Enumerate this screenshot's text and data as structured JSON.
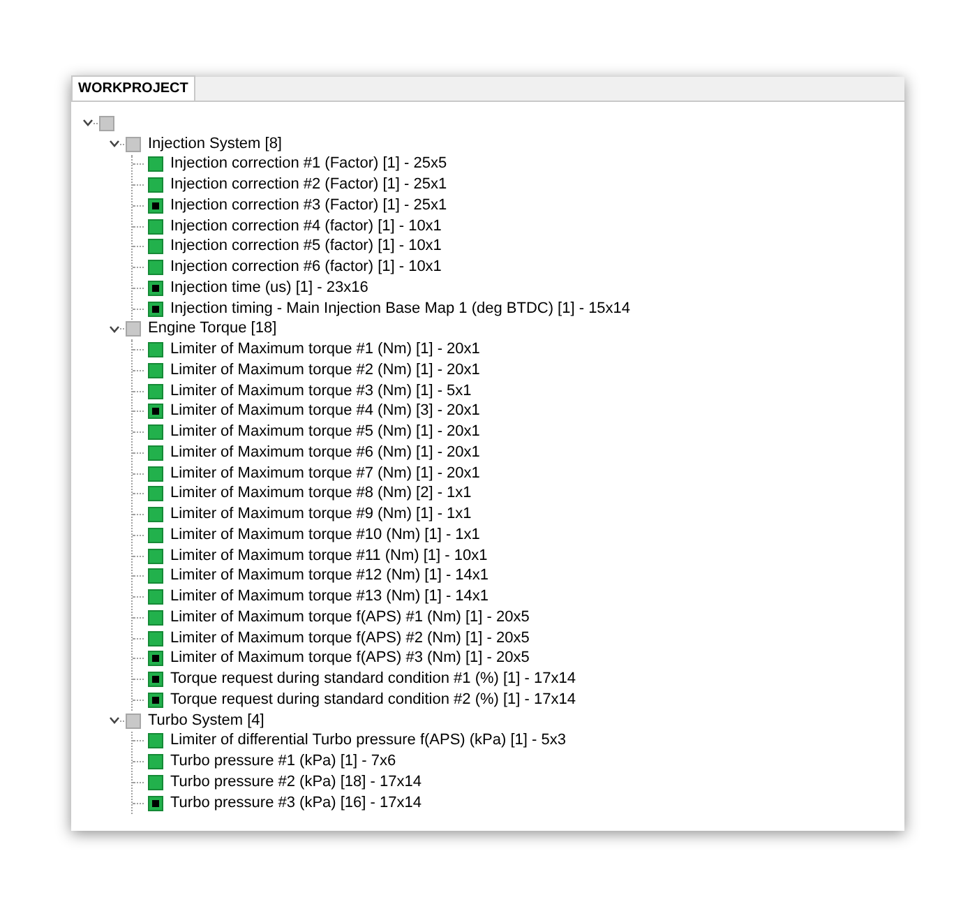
{
  "tab": {
    "label": "WORKPROJECT",
    "selected": true
  },
  "tree": {
    "expanded": true,
    "children": [
      {
        "label": "Injection System [8]",
        "expanded": true,
        "children": [
          {
            "label": "Injection correction #1 (Factor) [1] - 25x5",
            "marked": false
          },
          {
            "label": "Injection correction #2 (Factor) [1] - 25x1",
            "marked": false
          },
          {
            "label": "Injection correction #3 (Factor) [1] - 25x1",
            "marked": true
          },
          {
            "label": "Injection correction #4 (factor) [1] - 10x1",
            "marked": false
          },
          {
            "label": "Injection correction #5 (factor) [1] - 10x1",
            "marked": false
          },
          {
            "label": "Injection correction #6 (factor) [1] - 10x1",
            "marked": false
          },
          {
            "label": "Injection time (us) [1] - 23x16",
            "marked": true
          },
          {
            "label": "Injection timing - Main Injection Base Map 1 (deg BTDC) [1] - 15x14",
            "marked": true
          }
        ]
      },
      {
        "label": "Engine Torque [18]",
        "expanded": true,
        "children": [
          {
            "label": "Limiter of Maximum torque #1 (Nm) [1] - 20x1",
            "marked": false
          },
          {
            "label": "Limiter of Maximum torque #2 (Nm) [1] - 20x1",
            "marked": false
          },
          {
            "label": "Limiter of Maximum torque #3 (Nm) [1] - 5x1",
            "marked": false
          },
          {
            "label": "Limiter of Maximum torque #4 (Nm) [3] - 20x1",
            "marked": true
          },
          {
            "label": "Limiter of Maximum torque #5 (Nm) [1] - 20x1",
            "marked": false
          },
          {
            "label": "Limiter of Maximum torque #6 (Nm) [1] - 20x1",
            "marked": false
          },
          {
            "label": "Limiter of Maximum torque #7 (Nm) [1] - 20x1",
            "marked": false
          },
          {
            "label": "Limiter of Maximum torque #8 (Nm) [2] - 1x1",
            "marked": false
          },
          {
            "label": "Limiter of Maximum torque #9 (Nm) [1] - 1x1",
            "marked": false
          },
          {
            "label": "Limiter of Maximum torque #10 (Nm) [1] - 1x1",
            "marked": false
          },
          {
            "label": "Limiter of Maximum torque #11 (Nm) [1] - 10x1",
            "marked": false
          },
          {
            "label": "Limiter of Maximum torque #12 (Nm) [1] - 14x1",
            "marked": false
          },
          {
            "label": "Limiter of Maximum torque #13 (Nm) [1] - 14x1",
            "marked": false
          },
          {
            "label": "Limiter of Maximum torque f(APS) #1 (Nm) [1] - 20x5",
            "marked": false
          },
          {
            "label": "Limiter of Maximum torque f(APS) #2 (Nm) [1] - 20x5",
            "marked": false
          },
          {
            "label": "Limiter of Maximum torque f(APS) #3 (Nm) [1] - 20x5",
            "marked": true
          },
          {
            "label": "Torque request during standard condition #1 (%) [1] - 17x14",
            "marked": true
          },
          {
            "label": "Torque request during standard condition #2 (%) [1] - 17x14",
            "marked": true
          }
        ]
      },
      {
        "label": "Turbo System [4]",
        "expanded": true,
        "children": [
          {
            "label": "Limiter of differential Turbo pressure f(APS) (kPa) [1] - 5x3",
            "marked": false
          },
          {
            "label": "Turbo pressure #1 (kPa) [1] - 7x6",
            "marked": false
          },
          {
            "label": "Turbo pressure #2 (kPa) [18] - 17x14",
            "marked": false
          },
          {
            "label": "Turbo pressure #3 (kPa) [16] - 17x14",
            "marked": true
          }
        ]
      }
    ]
  }
}
